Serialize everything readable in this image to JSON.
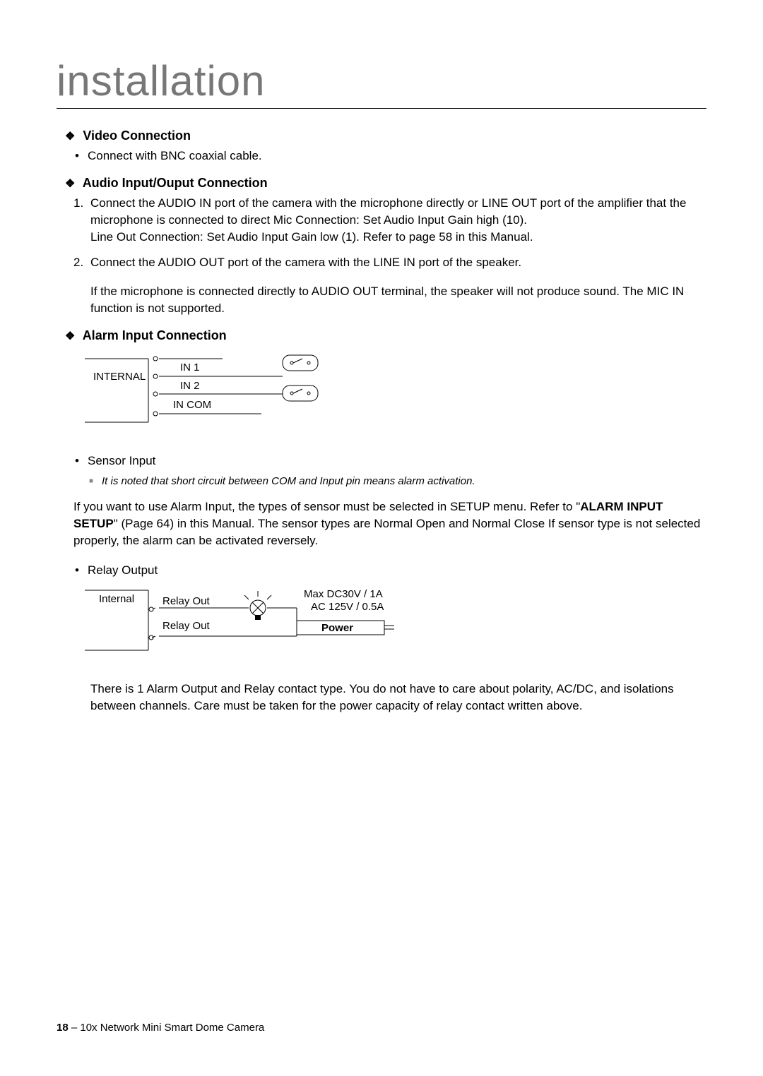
{
  "title": "installation",
  "video": {
    "heading": "Video Connection",
    "bullet1": "Connect with BNC coaxial cable."
  },
  "audio": {
    "heading": "Audio Input/Ouput Connection",
    "step1a": "Connect the AUDIO IN port of the camera with the microphone directly or LINE OUT port of the amplifier that the microphone is connected to direct Mic Connection: Set Audio Input Gain high (10).",
    "step1b": "Line Out Connection: Set Audio Input Gain low (1). Refer to page 58 in this Manual.",
    "step2": "Connect the AUDIO OUT port of the camera with the LINE IN port of the speaker.",
    "warning": "If the microphone is connected directly to AUDIO OUT terminal, the speaker will not produce sound. The MIC IN function is not supported."
  },
  "alarm": {
    "heading": "Alarm Input Connection",
    "diagram": {
      "internal": "INTERNAL",
      "in1": "IN 1",
      "in2": "IN 2",
      "incom": "IN COM"
    },
    "sensor_label": "Sensor Input",
    "sensor_note": "It is noted that short circuit between COM and Input pin means alarm activation.",
    "setup_note_pre": "If you want to use Alarm Input, the types of sensor must be selected in SETUP menu. Refer to \"",
    "setup_bold": "ALARM INPUT SETUP",
    "setup_note_post": "\" (Page 64) in this Manual. The sensor types are Normal Open and Normal Close If sensor type is not selected properly, the alarm can be activated reversely.",
    "relay_label": "Relay Output",
    "relay_diagram": {
      "internal": "Internal",
      "out1": "Relay Out",
      "out2": "Relay Out",
      "rating1": "Max DC30V / 1A",
      "rating2": "AC 125V / 0.5A",
      "power": "Power"
    },
    "relay_note": "There is 1 Alarm Output and Relay contact type. You do not have to care about polarity, AC/DC, and isolations between channels. Care must be taken for the power capacity of relay contact written above."
  },
  "footer": {
    "page": "18",
    "sep": "–",
    "product": "10x Network Mini Smart Dome Camera"
  }
}
